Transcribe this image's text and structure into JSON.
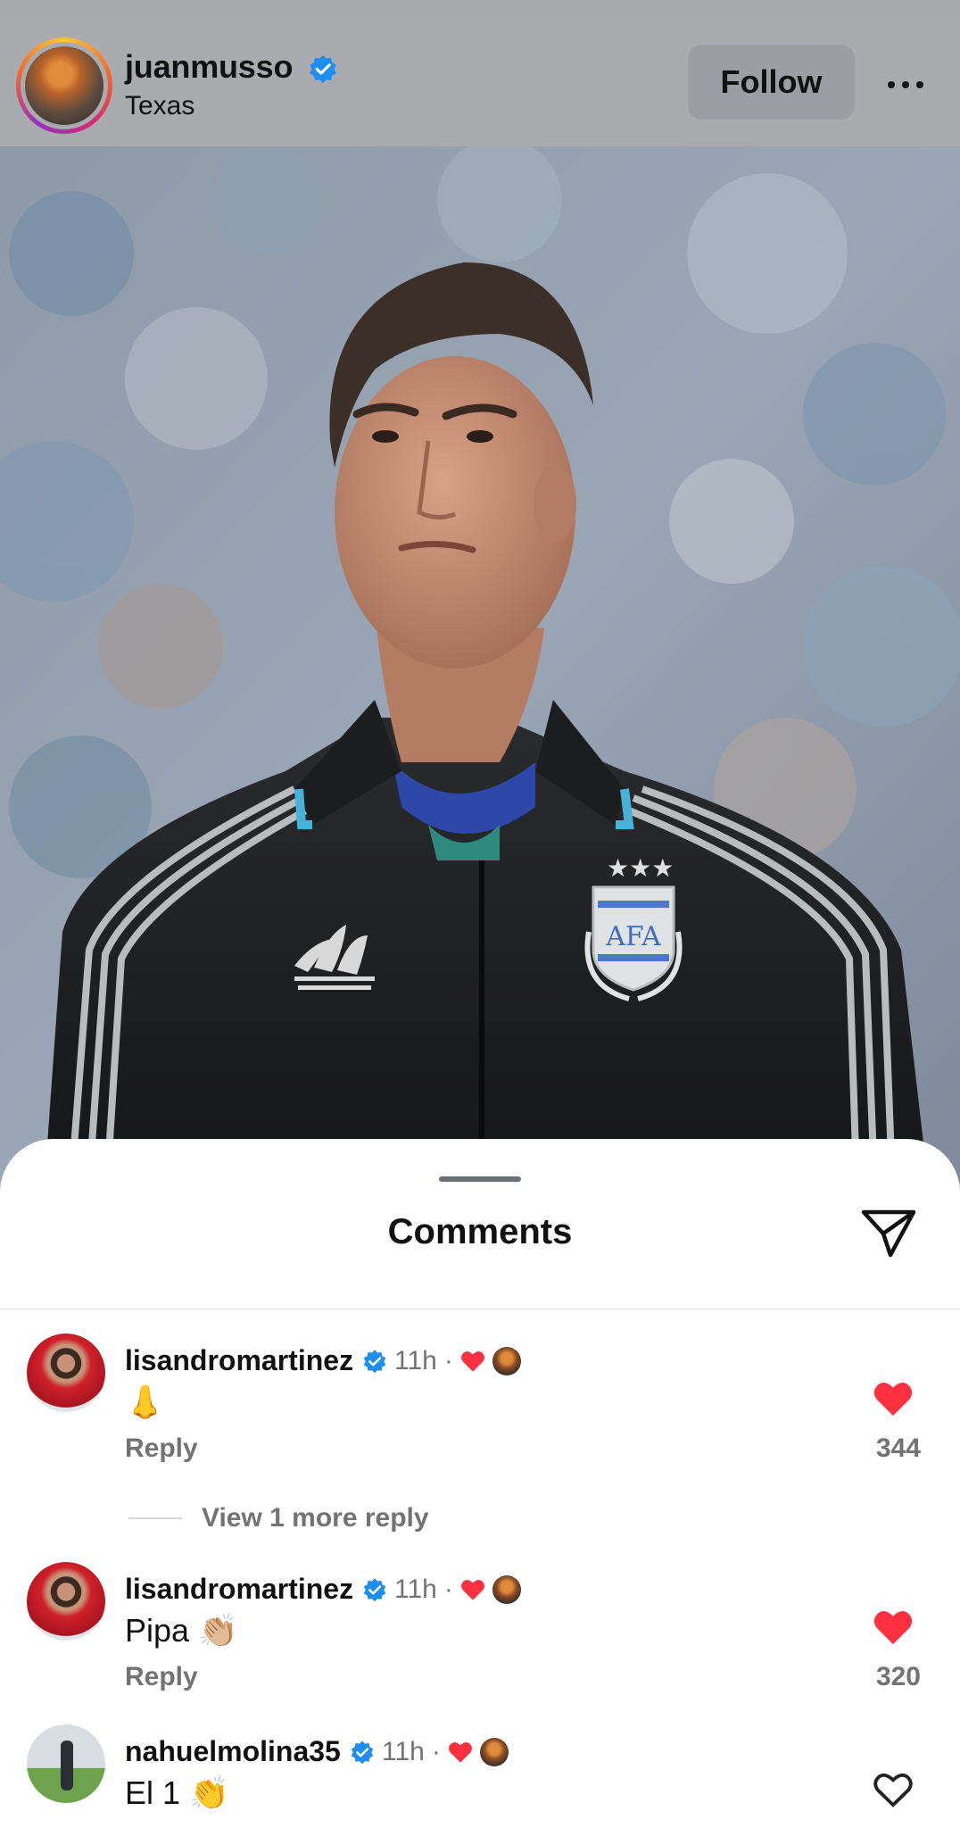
{
  "post": {
    "username": "juanmusso",
    "location": "Texas",
    "follow_label": "Follow",
    "jersey_badge": "AFA"
  },
  "comments_sheet": {
    "title": "Comments",
    "comments": [
      {
        "username": "lisandromartinez",
        "time": "11h",
        "separator": "·",
        "text": "👃",
        "reply_label": "Reply",
        "likes": "344",
        "liked": true,
        "view_more": "View 1 more reply"
      },
      {
        "username": "lisandromartinez",
        "time": "11h",
        "separator": "·",
        "text": "Pipa 👏🏼",
        "reply_label": "Reply",
        "likes": "320",
        "liked": true
      },
      {
        "username": "nahuelmolina35",
        "time": "11h",
        "separator": "·",
        "text": "El 1 👏",
        "liked": false
      }
    ]
  },
  "colors": {
    "like_red": "#ff3040",
    "verified_blue": "#1f8ef1",
    "muted_text": "#737373"
  }
}
